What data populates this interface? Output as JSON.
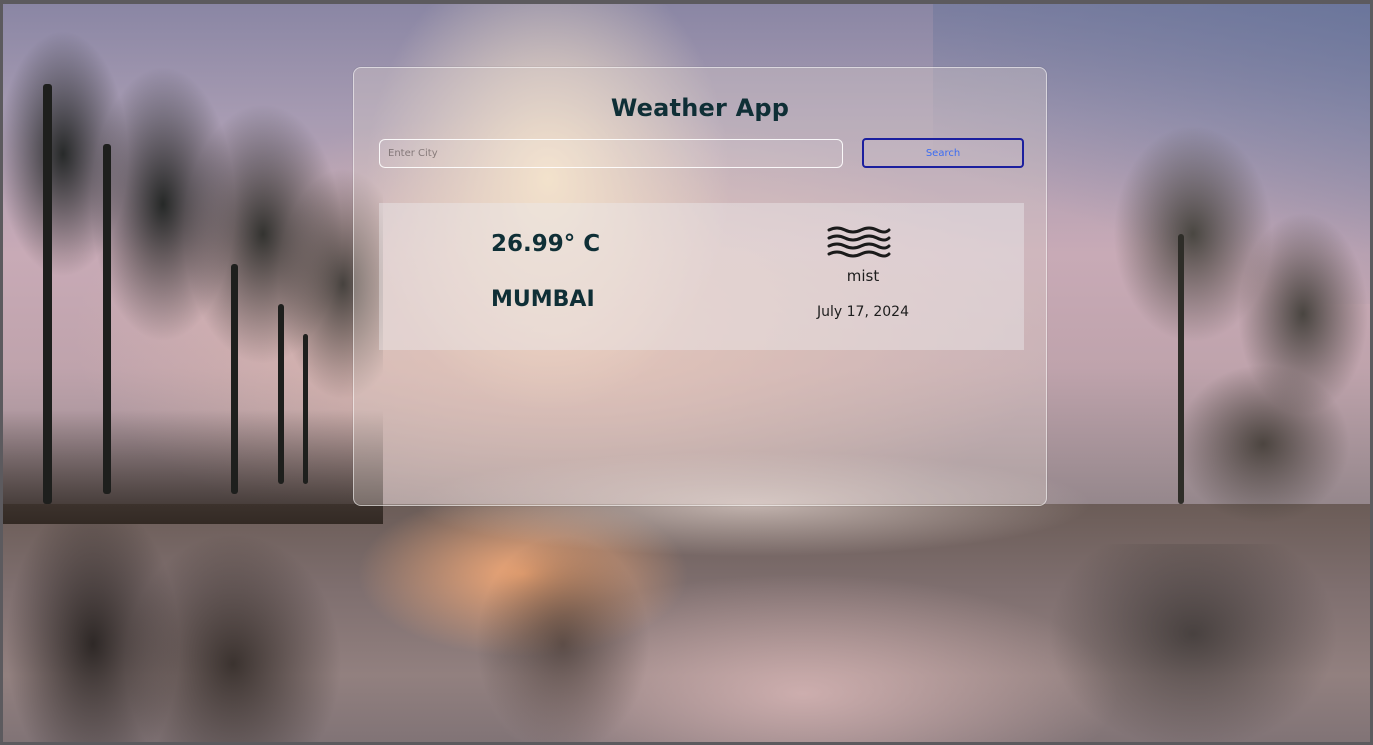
{
  "app": {
    "title": "Weather App"
  },
  "search": {
    "placeholder": "Enter City",
    "value": "",
    "button_label": "Search"
  },
  "weather": {
    "temperature": "26.99° C",
    "city": "MUMBAI",
    "condition": "mist",
    "date": "July 17, 2024",
    "icon": "mist-icon"
  },
  "colors": {
    "heading": "#0f2f36",
    "button_border": "#1b1f9e",
    "button_text": "#3b6cf2"
  }
}
